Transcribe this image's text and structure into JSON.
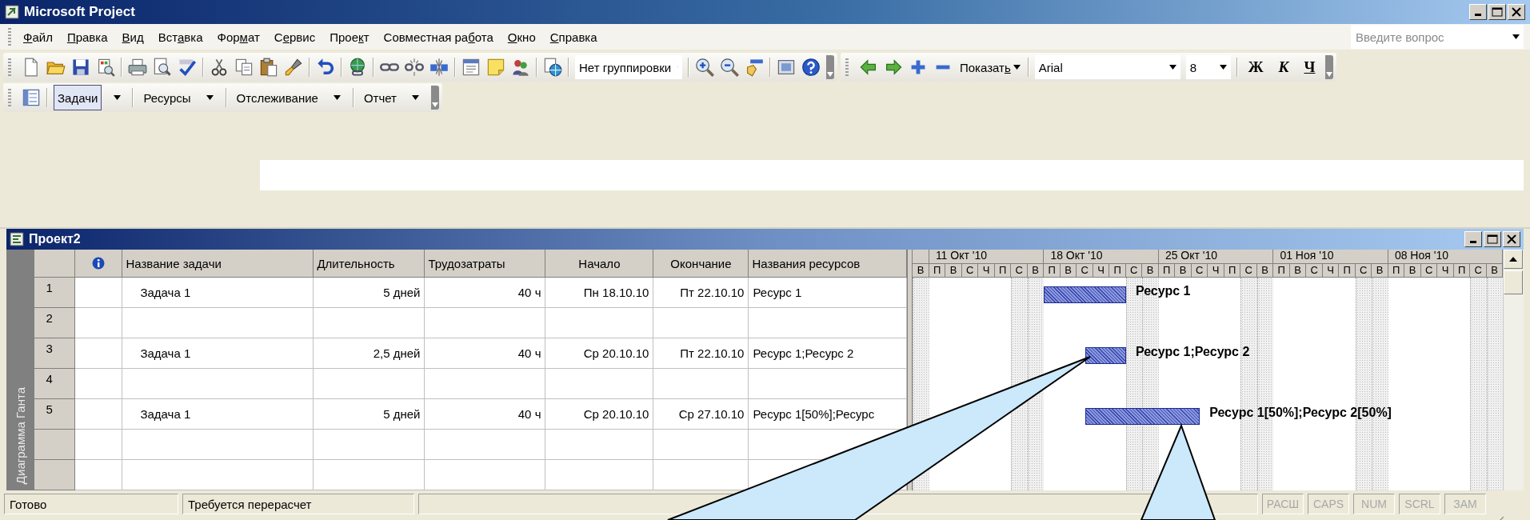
{
  "window": {
    "title": "Microsoft Project"
  },
  "menu": [
    {
      "key": "Ф",
      "post": "айл"
    },
    {
      "key": "П",
      "post": "равка"
    },
    {
      "key": "В",
      "post": "ид"
    },
    {
      "pre": "Вст",
      "key": "а",
      "post": "вка"
    },
    {
      "pre": "Фор",
      "key": "м",
      "post": "ат"
    },
    {
      "pre": "С",
      "key": "е",
      "post": "рвис"
    },
    {
      "pre": "Прое",
      "key": "к",
      "post": "т"
    },
    {
      "pre": "Совместная ра",
      "key": "б",
      "post": "ота"
    },
    {
      "key": "О",
      "post": "кно"
    },
    {
      "key": "С",
      "post": "правка"
    }
  ],
  "help_box": {
    "placeholder": "Введите вопрос"
  },
  "standard_toolbar": {
    "grouping": "Нет группировки"
  },
  "formatting_toolbar": {
    "show": {
      "pre": "Показат",
      "key": "ь"
    },
    "font": "Arial",
    "size": "8",
    "styles": [
      {
        "label": "Ж",
        "kind": "bold"
      },
      {
        "label": "К",
        "kind": "italic"
      },
      {
        "label": "Ч",
        "kind": "underline"
      }
    ]
  },
  "guide_toolbar": {
    "buttons": [
      {
        "label": "Задачи",
        "selected": true
      },
      {
        "label": "Ресурсы",
        "selected": false
      },
      {
        "label": "Отслеживание",
        "selected": false
      },
      {
        "label": "Отчет",
        "selected": false
      }
    ]
  },
  "project_window": {
    "title": "Проект2",
    "view_bar": "Диаграмма Ганта",
    "columns": [
      {
        "kind": "row_number"
      },
      {
        "kind": "indicator"
      },
      {
        "kind": "name",
        "label": "Название задачи"
      },
      {
        "kind": "duration",
        "label": "Длительность"
      },
      {
        "kind": "work",
        "label": "Трудозатраты"
      },
      {
        "kind": "start",
        "label": "Начало"
      },
      {
        "kind": "finish",
        "label": "Окончание"
      },
      {
        "kind": "resources",
        "label": "Названия ресурсов"
      }
    ],
    "rows": [
      {
        "id": "1",
        "name": "Задача 1",
        "duration": "5 дней",
        "work": "40 ч",
        "start": "Пн 18.10.10",
        "finish": "Пт 22.10.10",
        "resources": "Ресурс 1",
        "bar_label": "Ресурс 1"
      },
      {
        "id": "2"
      },
      {
        "id": "3",
        "name": "Задача 1",
        "duration": "2,5 дней",
        "work": "40 ч",
        "start": "Ср 20.10.10",
        "finish": "Пт 22.10.10",
        "resources": "Ресурс 1;Ресурс 2",
        "bar_label": "Ресурс 1;Ресурс 2"
      },
      {
        "id": "4"
      },
      {
        "id": "5",
        "name": "Задача 1",
        "duration": "5 дней",
        "work": "40 ч",
        "start": "Ср 20.10.10",
        "finish": "Ср 27.10.10",
        "resources": "Ресурс 1[50%];Ресурс",
        "bar_label": "Ресурс 1[50%];Ресурс 2[50%]"
      }
    ],
    "gantt": {
      "weeks": [
        "11 Окт '10",
        "18 Окт '10",
        "25 Окт '10",
        "01 Ноя '10",
        "08 Ноя '10"
      ],
      "days": [
        "В",
        "П",
        "В",
        "С",
        "Ч",
        "П",
        "С",
        "В",
        "П",
        "В",
        "С",
        "Ч",
        "П",
        "С",
        "В",
        "П",
        "В",
        "С",
        "Ч",
        "П",
        "С",
        "В",
        "П",
        "В",
        "С",
        "Ч",
        "П",
        "С",
        "В",
        "П",
        "В",
        "С",
        "Ч",
        "П",
        "С",
        "В"
      ]
    }
  },
  "status_bar": {
    "message": "Готово",
    "notice": "Требуется перерасчет",
    "indicators": [
      {
        "label": "РАСШ",
        "on": false
      },
      {
        "label": "CAPS",
        "on": false
      },
      {
        "label": "NUM",
        "on": false
      },
      {
        "label": "SCRL",
        "on": false
      },
      {
        "label": "ЗАМ",
        "on": false
      }
    ]
  }
}
